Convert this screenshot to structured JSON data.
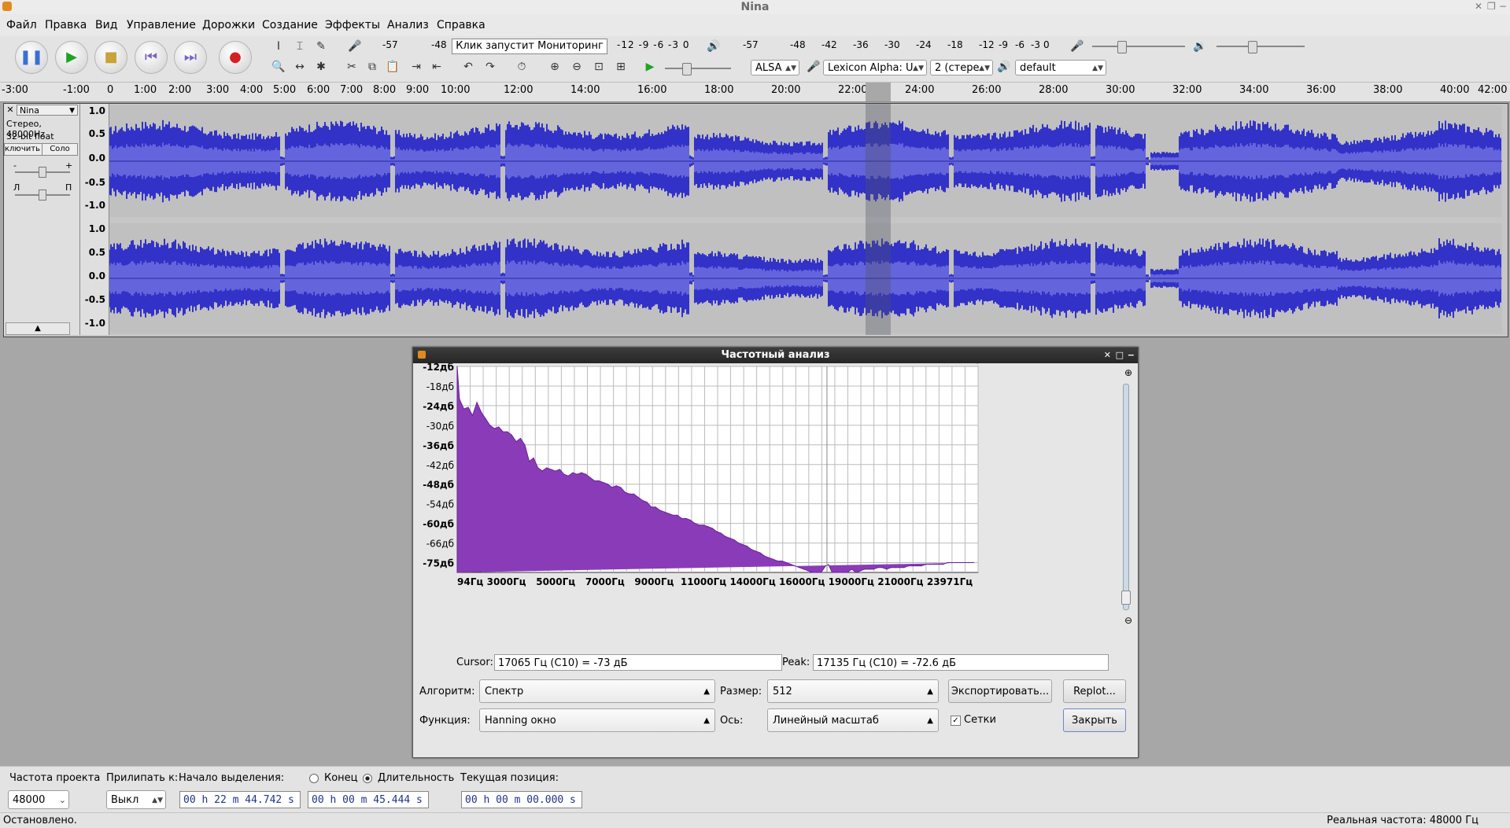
{
  "window": {
    "title": "Nina"
  },
  "menu": [
    "Файл",
    "Правка",
    "Вид",
    "Управление",
    "Дорожки",
    "Создание",
    "Эффекты",
    "Анализ",
    "Справка"
  ],
  "toolbar": {
    "meter_rec_ticks": [
      "-57",
      "-48"
    ],
    "monitor_label": "Клик запустит Мониторинг",
    "meter_rec_ticks_right": [
      "-12",
      "-9",
      "-6",
      "-3",
      "0"
    ],
    "meter_play_ticks": [
      "-57",
      "-48",
      "-42",
      "-36",
      "-30",
      "-24",
      "-18",
      "-12",
      "-9",
      "-6",
      "-3",
      "0"
    ],
    "host": "ALSA",
    "input_device": "Lexicon Alpha: U",
    "channels": "2 (стере",
    "output_device": "default"
  },
  "ruler": {
    "ticks": [
      "-3:00",
      "-1:00",
      "0",
      "1:00",
      "2:00",
      "3:00",
      "4:00",
      "5:00",
      "6:00",
      "7:00",
      "8:00",
      "9:00",
      "10:00",
      "12:00",
      "14:00",
      "16:00",
      "18:00",
      "20:00",
      "22:00",
      "24:00",
      "26:00",
      "28:00",
      "30:00",
      "32:00",
      "34:00",
      "36:00",
      "38:00",
      "40:00",
      "42:00"
    ]
  },
  "track": {
    "name": "Nina",
    "info1": "Стерео, 48000Hz",
    "info2": "32-bit float",
    "mute_label": "ключить звук",
    "solo_label": "Соло",
    "gain_minus": "-",
    "gain_plus": "+",
    "pan_left": "Л",
    "pan_right": "П",
    "scale": [
      "1.0",
      "0.5",
      "0.0",
      "-0.5",
      "-1.0"
    ]
  },
  "dialog": {
    "title": "Частотный анализ",
    "y_ticks": [
      "-12дб",
      "-18дб",
      "-24дб",
      "-30дб",
      "-36дб",
      "-42дб",
      "-48дб",
      "-54дб",
      "-60дб",
      "-66дб",
      "-75дб"
    ],
    "x_ticks": [
      "94Гц",
      "3000Гц",
      "5000Гц",
      "7000Гц",
      "9000Гц",
      "11000Гц",
      "14000Гц",
      "16000Гц",
      "19000Гц",
      "21000Гц",
      "23971Гц"
    ],
    "cursor_label": "Cursor:",
    "cursor_value": "17065 Гц (C10) = -73 дБ",
    "peak_label": "Peak:",
    "peak_value": "17135 Гц (C10) = -72.6 дБ",
    "algorithm_label": "Алгоритм:",
    "algorithm_value": "Спектр",
    "size_label": "Размер:",
    "size_value": "512",
    "export_button": "Экспортировать...",
    "replot_button": "Replot...",
    "function_label": "Функция:",
    "function_value": "Hanning окно",
    "axis_label": "Ось:",
    "axis_value": "Линейный масштаб",
    "grid_label": "Сетки",
    "close_button": "Закрыть",
    "colors": {
      "fill": "#8a3cb8",
      "grid": "#bbbbbb"
    }
  },
  "chart_data": {
    "type": "area",
    "title": "",
    "xlabel": "",
    "ylabel": "",
    "xlim": [
      94,
      24000
    ],
    "ylim": [
      -75,
      -12
    ],
    "grid": true,
    "x": [
      94,
      200,
      400,
      600,
      800,
      1000,
      1200,
      1400,
      1600,
      1800,
      2000,
      2200,
      2400,
      2600,
      2800,
      3000,
      3200,
      3400,
      3600,
      3800,
      4000,
      4200,
      4400,
      4600,
      4800,
      5000,
      5200,
      5400,
      5600,
      5800,
      6000,
      6200,
      6400,
      6600,
      6800,
      7000,
      7200,
      7400,
      7600,
      7800,
      8000,
      8200,
      8400,
      8600,
      8800,
      9000,
      9200,
      9400,
      9600,
      9800,
      10000,
      10200,
      10400,
      10600,
      10800,
      11000,
      11200,
      11400,
      11600,
      11800,
      12000,
      12200,
      12400,
      12600,
      12800,
      13000,
      13200,
      13400,
      13600,
      13800,
      14000,
      14200,
      14400,
      14600,
      14800,
      15000,
      15200,
      15400,
      15600,
      15800,
      16000,
      16200,
      16400,
      16600,
      16800,
      17000,
      17135,
      17300,
      17500,
      17800,
      18000,
      18200,
      18400,
      18600,
      18800,
      19000,
      19200,
      19400,
      19600,
      19800,
      20000,
      20200,
      20400,
      20600,
      20800,
      21000,
      21200,
      21400,
      21600,
      21800,
      22000,
      22200,
      22400,
      22600,
      22800,
      23000,
      23200,
      23400,
      23600,
      23800,
      23971
    ],
    "values": [
      -12,
      -22,
      -25,
      -24.5,
      -27,
      -23,
      -26,
      -28,
      -30,
      -31,
      -30.5,
      -32,
      -32,
      -33,
      -35,
      -34,
      -36,
      -41,
      -40,
      -43,
      -44,
      -43,
      -43.5,
      -44,
      -43.5,
      -45,
      -45.5,
      -44.5,
      -45,
      -44.5,
      -45,
      -46,
      -47,
      -47,
      -47.5,
      -48,
      -49,
      -48.5,
      -49,
      -50.5,
      -51,
      -51,
      -52,
      -53,
      -53.5,
      -55,
      -55,
      -56,
      -56.5,
      -57,
      -57.5,
      -57.5,
      -58.5,
      -58.5,
      -59,
      -60,
      -60.5,
      -60.5,
      -61,
      -61.5,
      -62.5,
      -63,
      -64,
      -64.5,
      -65,
      -66,
      -66.5,
      -67,
      -68,
      -68.5,
      -69,
      -70,
      -70.5,
      -71,
      -71.5,
      -71.5,
      -72,
      -72.5,
      -73,
      -73.5,
      -74,
      -74.5,
      -75,
      -75,
      -75,
      -73,
      -72.6,
      -75,
      -75,
      -75,
      -75,
      -74,
      -75,
      -74.5,
      -74,
      -74,
      -74,
      -73.5,
      -73.5,
      -74,
      -73.5,
      -73.5,
      -73.5,
      -73.5,
      -73,
      -73,
      -73,
      -73,
      -72.5,
      -72.5,
      -72.5,
      -72.5,
      -72.5,
      -72,
      -72,
      -72,
      -72,
      -72,
      -72,
      -72
    ]
  },
  "selection_bar": {
    "rate_label": "Частота проекта",
    "rate_value": "48000",
    "snap_label": "Прилипать к:",
    "snap_value": "Выкл",
    "start_label": "Начало выделения:",
    "end_radio": "Конец",
    "length_radio": "Длительность",
    "position_label": "Текущая позиция:",
    "start_value": "00 h 22 m 44.742 s",
    "length_value": "00 h 00 m 45.444 s",
    "position_value": "00 h 00 m 00.000 s"
  },
  "status": {
    "left": "Остановлено.",
    "right": "Реальная частота: 48000 Гц"
  }
}
